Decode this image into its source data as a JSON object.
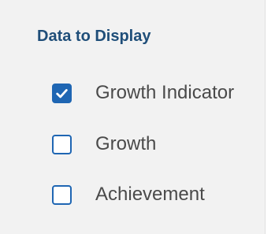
{
  "panel": {
    "title": "Data to Display",
    "accent_color": "#1f66b3",
    "title_color": "#1f4e79",
    "options": [
      {
        "label": "Growth Indicator",
        "checked": true,
        "icon": "checkmark-icon"
      },
      {
        "label": "Growth",
        "checked": false
      },
      {
        "label": "Achievement",
        "checked": false
      }
    ]
  }
}
